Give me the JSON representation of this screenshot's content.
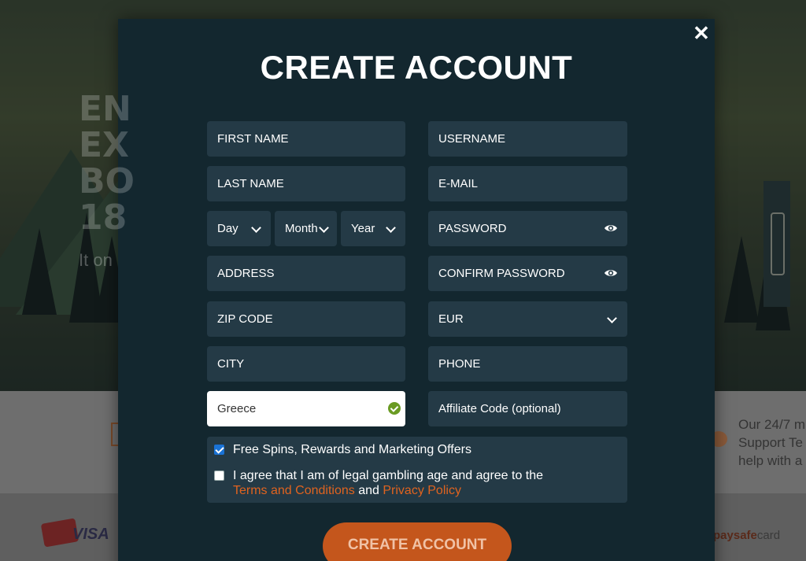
{
  "background": {
    "hero_lines": [
      "EN",
      "EX",
      "BO",
      "18"
    ],
    "hero_sub": "It on",
    "support_lines": [
      "Our 24/7 m",
      "Support Te",
      "help with a"
    ],
    "payments": {
      "visa": "VISA",
      "paysafe_a": "paysafe",
      "paysafe_b": "card"
    }
  },
  "modal": {
    "title": "CREATE ACCOUNT",
    "close_label": "✕",
    "left_fields": {
      "first_name": "FIRST NAME",
      "last_name": "LAST NAME",
      "day": "Day",
      "month": "Month",
      "year": "Year",
      "address": "ADDRESS",
      "zip": "ZIP CODE",
      "city": "CITY",
      "country": "Greece"
    },
    "right_fields": {
      "username": "USERNAME",
      "email": "E-MAIL",
      "password": "PASSWORD",
      "confirm_password": "CONFIRM PASSWORD",
      "currency": "EUR",
      "phone": "PHONE",
      "affiliate": "Affiliate Code (optional)"
    },
    "consent": {
      "marketing": "Free Spins, Rewards and Marketing Offers",
      "agree_prefix": "I agree that I am of legal gambling age and agree to the",
      "terms_link": "Terms and Conditions",
      "and": "and",
      "privacy_link": "Privacy Policy"
    },
    "submit_label": "CREATE ACCOUNT"
  },
  "colors": {
    "accent": "#e0631f",
    "button": "#c4561c",
    "modal_bg": "#13272f",
    "field_bg": "#243a46",
    "check_green": "#6a9b23"
  }
}
